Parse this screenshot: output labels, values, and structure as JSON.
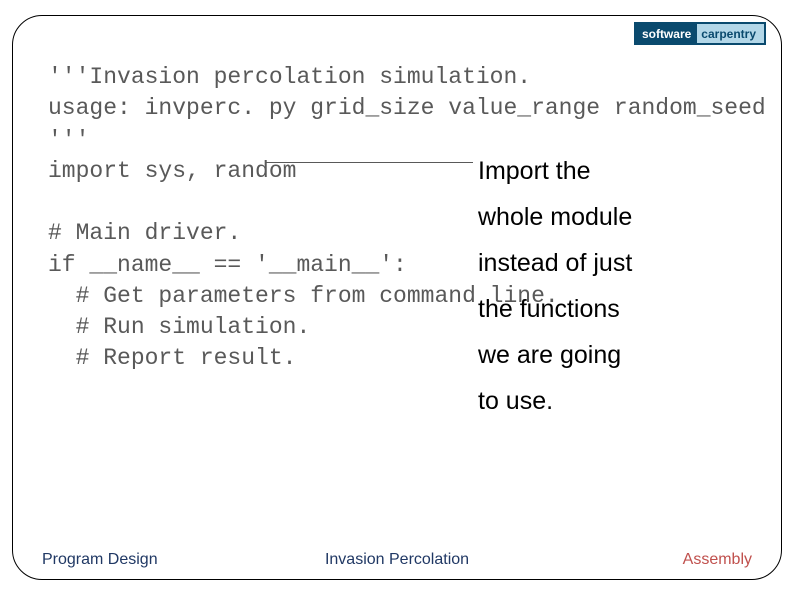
{
  "logo": {
    "left": "software",
    "right": "carpentry",
    "tagline": ""
  },
  "code": {
    "line1": "'''Invasion percolation simulation.",
    "line2": "usage: invperc. py grid_size value_range random_seed",
    "line3": "'''",
    "line4": "import sys, random",
    "line5": "",
    "line6": "# Main driver.",
    "line7": "if __name__ == '__main__':",
    "line8": "  # Get parameters from command line.",
    "line9": "  # Run simulation.",
    "line10": "  # Report result."
  },
  "annotation": {
    "l1": "Import the",
    "l2": "whole module",
    "l3": "instead of just",
    "l4": "the functions",
    "l5": "we are going",
    "l6": "to use."
  },
  "footer": {
    "left": "Program Design",
    "center": "Invasion Percolation",
    "right": "Assembly"
  }
}
